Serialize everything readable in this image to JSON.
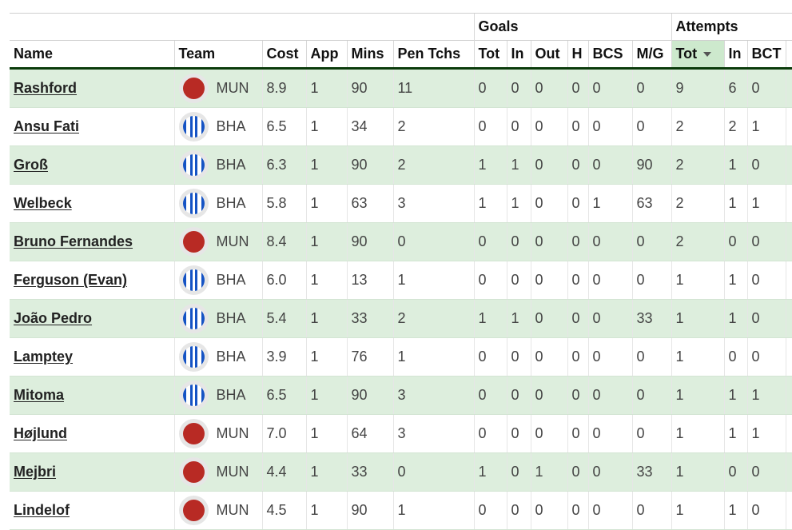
{
  "table": {
    "groups": {
      "goals": "Goals",
      "attempts": "Attempts"
    },
    "columns": {
      "name": "Name",
      "team": "Team",
      "cost": "Cost",
      "app": "App",
      "mins": "Mins",
      "pen_tchs": "Pen Tchs",
      "goals_tot": "Tot",
      "goals_in": "In",
      "goals_out": "Out",
      "goals_h": "H",
      "goals_bcs": "BCS",
      "goals_mg": "M/G",
      "att_tot": "Tot",
      "att_in": "In",
      "att_bct": "BCT"
    },
    "sorted_column": "att_tot",
    "sort_direction": "descending",
    "team_colors": {
      "MUN": "#b82a24",
      "BHA": "#1553c4"
    },
    "rows": [
      {
        "name": "Rashford",
        "team": "MUN",
        "cost": "8.9",
        "app": "1",
        "mins": "90",
        "pen": "11",
        "gtot": "0",
        "gin": "0",
        "gout": "0",
        "h": "0",
        "bcs": "0",
        "mg": "0",
        "atot": "9",
        "ain": "6",
        "bct": "0"
      },
      {
        "name": "Ansu Fati",
        "team": "BHA",
        "cost": "6.5",
        "app": "1",
        "mins": "34",
        "pen": "2",
        "gtot": "0",
        "gin": "0",
        "gout": "0",
        "h": "0",
        "bcs": "0",
        "mg": "0",
        "atot": "2",
        "ain": "2",
        "bct": "1"
      },
      {
        "name": "Groß",
        "team": "BHA",
        "cost": "6.3",
        "app": "1",
        "mins": "90",
        "pen": "2",
        "gtot": "1",
        "gin": "1",
        "gout": "0",
        "h": "0",
        "bcs": "0",
        "mg": "90",
        "atot": "2",
        "ain": "1",
        "bct": "0"
      },
      {
        "name": "Welbeck",
        "team": "BHA",
        "cost": "5.8",
        "app": "1",
        "mins": "63",
        "pen": "3",
        "gtot": "1",
        "gin": "1",
        "gout": "0",
        "h": "0",
        "bcs": "1",
        "mg": "63",
        "atot": "2",
        "ain": "1",
        "bct": "1"
      },
      {
        "name": "Bruno Fernandes",
        "team": "MUN",
        "cost": "8.4",
        "app": "1",
        "mins": "90",
        "pen": "0",
        "gtot": "0",
        "gin": "0",
        "gout": "0",
        "h": "0",
        "bcs": "0",
        "mg": "0",
        "atot": "2",
        "ain": "0",
        "bct": "0"
      },
      {
        "name": "Ferguson (Evan)",
        "team": "BHA",
        "cost": "6.0",
        "app": "1",
        "mins": "13",
        "pen": "1",
        "gtot": "0",
        "gin": "0",
        "gout": "0",
        "h": "0",
        "bcs": "0",
        "mg": "0",
        "atot": "1",
        "ain": "1",
        "bct": "0"
      },
      {
        "name": "João Pedro",
        "team": "BHA",
        "cost": "5.4",
        "app": "1",
        "mins": "33",
        "pen": "2",
        "gtot": "1",
        "gin": "1",
        "gout": "0",
        "h": "0",
        "bcs": "0",
        "mg": "33",
        "atot": "1",
        "ain": "1",
        "bct": "0"
      },
      {
        "name": "Lamptey",
        "team": "BHA",
        "cost": "3.9",
        "app": "1",
        "mins": "76",
        "pen": "1",
        "gtot": "0",
        "gin": "0",
        "gout": "0",
        "h": "0",
        "bcs": "0",
        "mg": "0",
        "atot": "1",
        "ain": "0",
        "bct": "0"
      },
      {
        "name": "Mitoma",
        "team": "BHA",
        "cost": "6.5",
        "app": "1",
        "mins": "90",
        "pen": "3",
        "gtot": "0",
        "gin": "0",
        "gout": "0",
        "h": "0",
        "bcs": "0",
        "mg": "0",
        "atot": "1",
        "ain": "1",
        "bct": "1"
      },
      {
        "name": "Højlund",
        "team": "MUN",
        "cost": "7.0",
        "app": "1",
        "mins": "64",
        "pen": "3",
        "gtot": "0",
        "gin": "0",
        "gout": "0",
        "h": "0",
        "bcs": "0",
        "mg": "0",
        "atot": "1",
        "ain": "1",
        "bct": "1"
      },
      {
        "name": "Mejbri",
        "team": "MUN",
        "cost": "4.4",
        "app": "1",
        "mins": "33",
        "pen": "0",
        "gtot": "1",
        "gin": "0",
        "gout": "1",
        "h": "0",
        "bcs": "0",
        "mg": "33",
        "atot": "1",
        "ain": "0",
        "bct": "0"
      },
      {
        "name": "Lindelof",
        "team": "MUN",
        "cost": "4.5",
        "app": "1",
        "mins": "90",
        "pen": "1",
        "gtot": "0",
        "gin": "0",
        "gout": "0",
        "h": "0",
        "bcs": "0",
        "mg": "0",
        "atot": "1",
        "ain": "1",
        "bct": "0"
      }
    ]
  }
}
